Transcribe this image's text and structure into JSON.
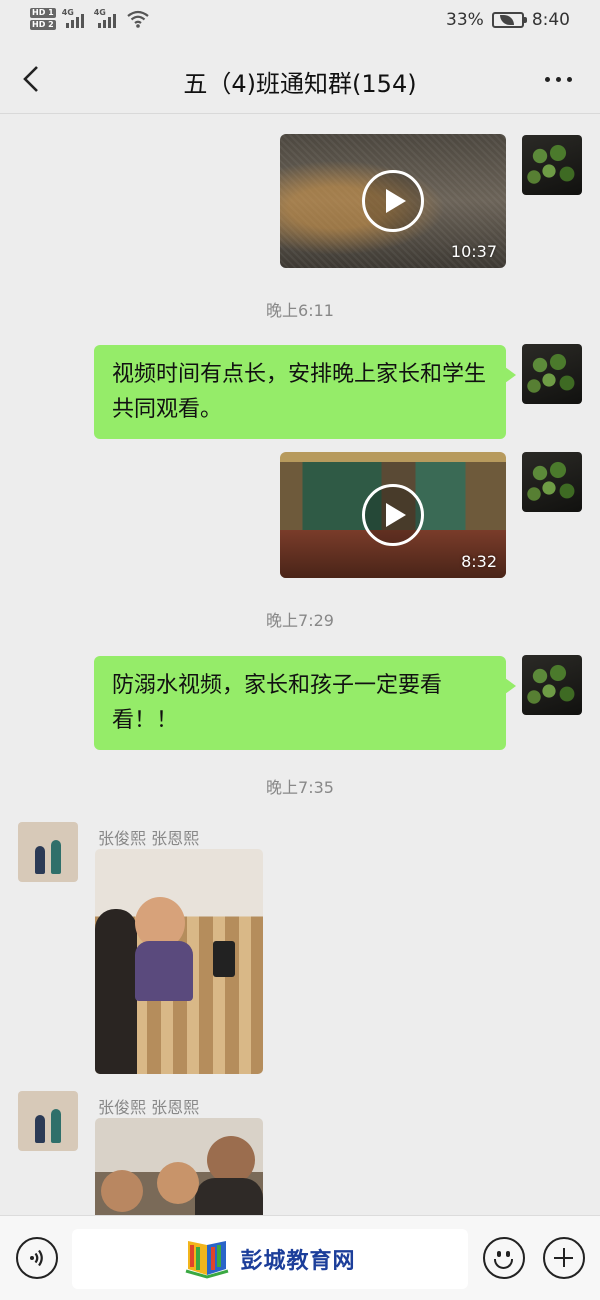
{
  "status_bar": {
    "network_1": "HD 1",
    "network_2": "HD 2",
    "signal_1": "4G",
    "signal_2": "4G",
    "battery_percent": "33%",
    "time": "8:40"
  },
  "header": {
    "title": "五（4)班通知群(154)"
  },
  "messages": {
    "video_1_duration": "10:37",
    "time_1": "晚上6:11",
    "text_1": "视频时间有点长，安排晚上家长和学生共同观看。",
    "video_2_duration": "8:32",
    "time_2": "晚上7:29",
    "text_2": "防溺水视频，家长和孩子一定要看看！！",
    "time_3": "晚上7:35",
    "sender_1": "张俊熙  张恩熙",
    "sender_2": "张俊熙  张恩熙"
  },
  "input_bar": {
    "logo_text": "彭城教育网"
  },
  "colors": {
    "bubble_green": "#95ec69",
    "background": "#ededed",
    "logo_blue": "#1c3e9a"
  },
  "icons": {
    "back": "back-arrow-icon",
    "more": "more-dots-icon",
    "voice": "voice-icon",
    "emoji": "emoji-icon",
    "plus": "plus-icon",
    "play": "play-icon"
  }
}
